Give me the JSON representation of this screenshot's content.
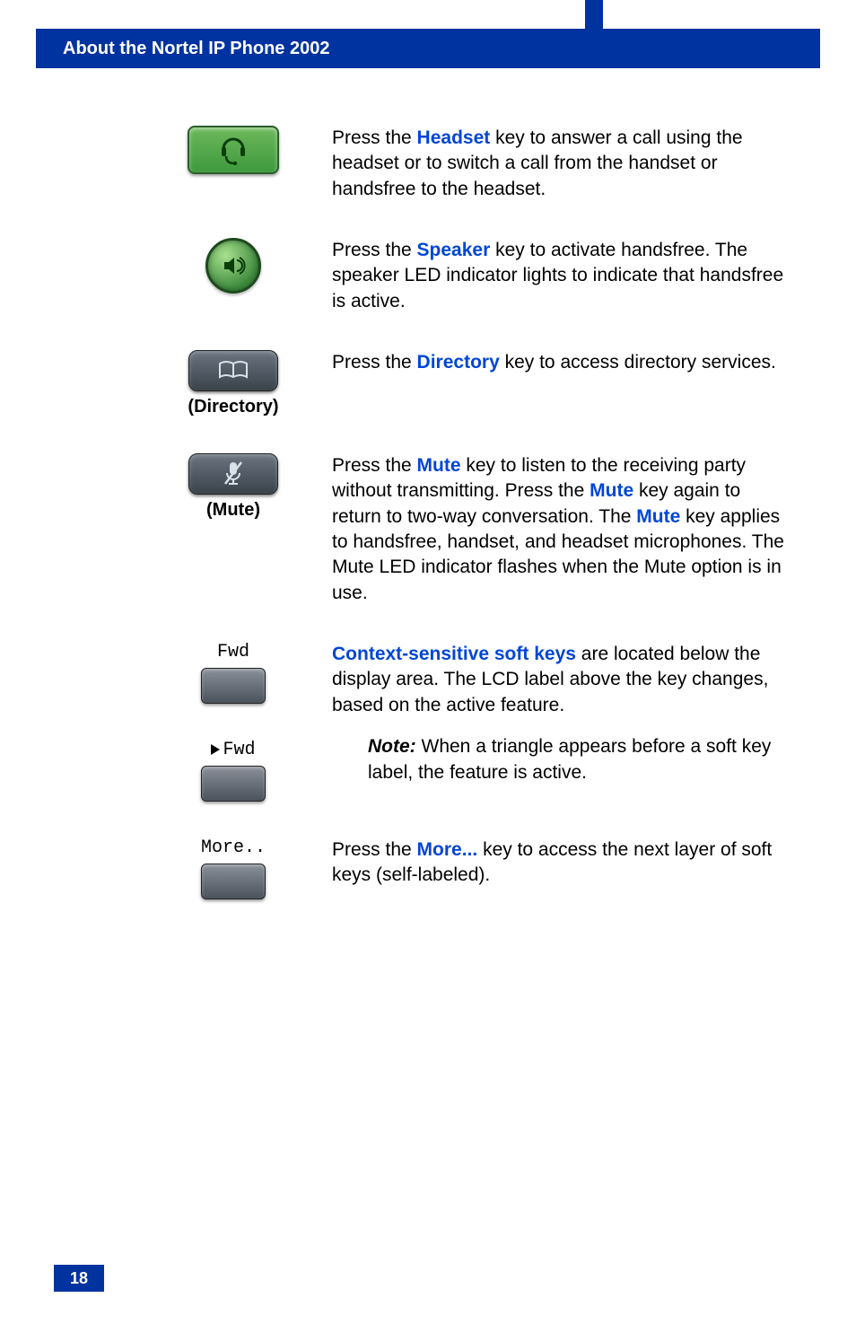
{
  "header": {
    "title": "About the Nortel IP Phone 2002"
  },
  "rows": {
    "headset": {
      "t1": "Press the ",
      "kw": "Headset",
      "t2": " key to answer a call using the headset or to switch a call from the handset or handsfree to the headset."
    },
    "speaker": {
      "t1": "Press the ",
      "kw": "Speaker",
      "t2": " key to activate handsfree. The speaker LED indicator lights to indicate that handsfree is active."
    },
    "directory": {
      "caption": "(Directory)",
      "t1": "Press the ",
      "kw": "Directory",
      "t2": " key to access directory services."
    },
    "mute": {
      "caption": "(Mute)",
      "t1": "Press the ",
      "kw1": "Mute",
      "t2": " key to listen to the receiving party without transmitting. Press the ",
      "kw2": "Mute",
      "t3": " key again to return to two-way conversation. The ",
      "kw3": "Mute",
      "t4": " key applies to handsfree, handset, and headset microphones. The Mute LED indicator flashes when the Mute option is in use."
    },
    "softkeys": {
      "label_fwd": "Fwd",
      "label_fwd_active": "Fwd",
      "kw": "Context-sensitive soft keys",
      "t1": " are located below the display area. The LCD label above the key changes, based on the active feature.",
      "note_label": "Note:",
      "note_text": " When a triangle appears before a soft key label, the feature is active."
    },
    "more": {
      "label": "More..",
      "t1": "Press the ",
      "kw": "More...",
      "t2": " key to access the next layer of soft keys (self-labeled)."
    }
  },
  "page_number": "18"
}
